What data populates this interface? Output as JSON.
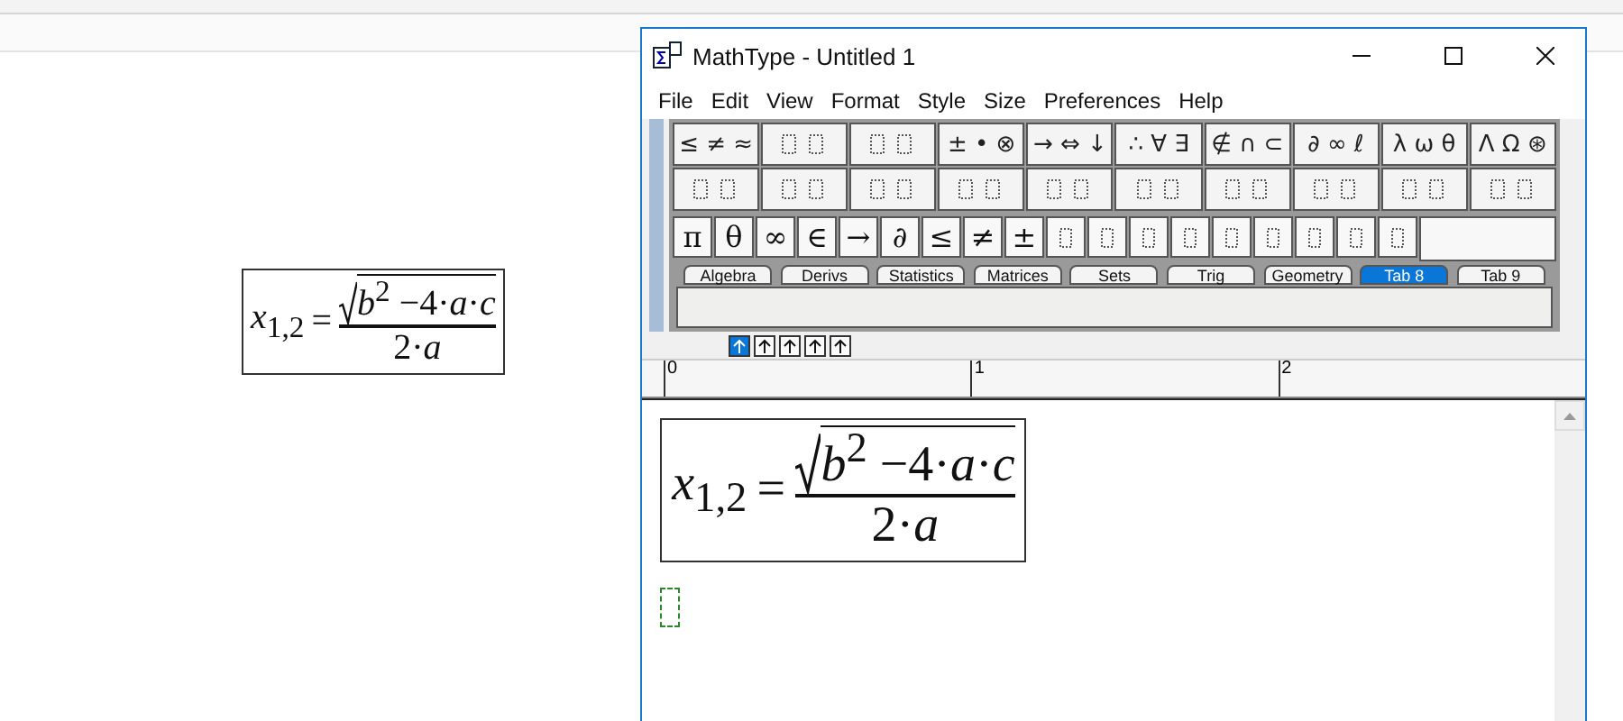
{
  "document_equation": {
    "lhs": "*x*$_{1,2}$",
    "equals": "=",
    "radicand": "*b*$^{2}$ −4·*a*·*c*",
    "denominator": "2·*a*"
  },
  "window": {
    "title": "MathType - Untitled 1"
  },
  "menu": [
    "File",
    "Edit",
    "View",
    "Format",
    "Style",
    "Size",
    "Preferences",
    "Help"
  ],
  "palette_row_1": [
    {
      "kind": "symbol",
      "label": "≤ ≠ ≈"
    },
    {
      "kind": "template"
    },
    {
      "kind": "template"
    },
    {
      "kind": "symbol",
      "label": "± • ⊗"
    },
    {
      "kind": "symbol",
      "label": "→ ⇔ ↓"
    },
    {
      "kind": "symbol",
      "label": "∴ ∀ ∃"
    },
    {
      "kind": "symbol",
      "label": "∉ ∩ ⊂"
    },
    {
      "kind": "symbol",
      "label": "∂ ∞ ℓ"
    },
    {
      "kind": "symbol",
      "label": "λ ω θ"
    },
    {
      "kind": "symbol",
      "label": "Λ Ω ⊛"
    }
  ],
  "palette_row_2": [
    {
      "kind": "template"
    },
    {
      "kind": "template"
    },
    {
      "kind": "template"
    },
    {
      "kind": "template"
    },
    {
      "kind": "template"
    },
    {
      "kind": "template"
    },
    {
      "kind": "template"
    },
    {
      "kind": "template"
    },
    {
      "kind": "template"
    },
    {
      "kind": "template"
    }
  ],
  "small_bar": [
    {
      "kind": "symbol",
      "label": "π"
    },
    {
      "kind": "symbol",
      "label": "θ"
    },
    {
      "kind": "symbol",
      "label": "∞"
    },
    {
      "kind": "symbol",
      "label": "∈"
    },
    {
      "kind": "symbol",
      "label": "→"
    },
    {
      "kind": "symbol",
      "label": "∂"
    },
    {
      "kind": "symbol",
      "label": "≤"
    },
    {
      "kind": "symbol",
      "label": "≠"
    },
    {
      "kind": "symbol",
      "label": "±"
    },
    {
      "kind": "template"
    },
    {
      "kind": "template"
    },
    {
      "kind": "template"
    },
    {
      "kind": "template"
    },
    {
      "kind": "template"
    },
    {
      "kind": "template"
    },
    {
      "kind": "template"
    },
    {
      "kind": "template"
    },
    {
      "kind": "template"
    }
  ],
  "tabs": [
    {
      "label": "Algebra",
      "selected": false
    },
    {
      "label": "Derivs",
      "selected": false
    },
    {
      "label": "Statistics",
      "selected": false
    },
    {
      "label": "Matrices",
      "selected": false
    },
    {
      "label": "Sets",
      "selected": false
    },
    {
      "label": "Trig",
      "selected": false
    },
    {
      "label": "Geometry",
      "selected": false
    },
    {
      "label": "Tab 8",
      "selected": true
    },
    {
      "label": "Tab 9",
      "selected": false
    }
  ],
  "nudge_buttons": [
    {
      "selected": true
    },
    {
      "selected": false
    },
    {
      "selected": false
    },
    {
      "selected": false
    },
    {
      "selected": false
    }
  ],
  "ruler": [
    "0",
    "1",
    "2"
  ],
  "editor_equation": {
    "lhs": "*x*$_{1,2}$",
    "equals": "=",
    "radicand": "*b*$^{2}$ −4·*a*·*c*",
    "denominator": "2·*a*"
  }
}
